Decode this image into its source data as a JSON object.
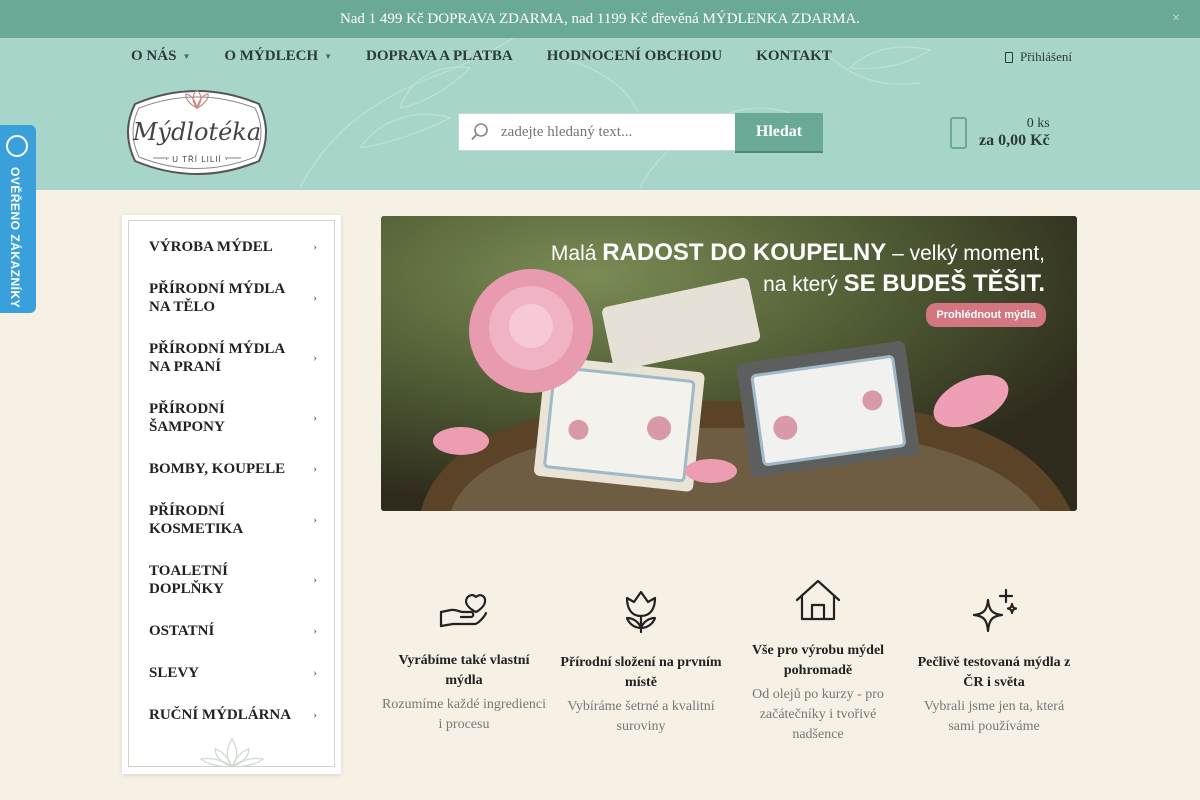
{
  "topbar": {
    "text": "Nad 1 499 Kč DOPRAVA ZDARMA, nad 1199 Kč dřevěná MÝDLENKA ZDARMA.",
    "close": "×"
  },
  "nav": {
    "items": [
      "O NÁS",
      "O MÝDLECH",
      "DOPRAVA A PLATBA",
      "HODNOCENÍ OBCHODU",
      "KONTAKT"
    ],
    "login": "Přihlášení"
  },
  "logo": {
    "name": "Mýdlotéka",
    "tagline": "U TŘÍ LILIÍ"
  },
  "search": {
    "placeholder": "zadejte hledaný text...",
    "button": "Hledat"
  },
  "cart": {
    "count": "0 ks",
    "total": "za 0,00 Kč"
  },
  "badge": {
    "text": "OVĚŘENO ZÁKAZNÍKY"
  },
  "sidebar": {
    "categories": [
      "VÝROBA MÝDEL",
      "PŘÍRODNÍ MÝDLA NA TĚLO",
      "PŘÍRODNÍ MÝDLA NA PRANÍ",
      "PŘÍRODNÍ ŠAMPONY",
      "BOMBY, KOUPELE",
      "PŘÍRODNÍ KOSMETIKA",
      "TOALETNÍ DOPLŇKY",
      "OSTATNÍ",
      "SLEVY",
      "RUČNÍ MÝDLÁRNA"
    ]
  },
  "banner": {
    "line1_a": "Malá ",
    "line1_b": "RADOST DO KOUPELNY",
    "line1_c": " – velký moment,",
    "line2_a": "na který ",
    "line2_b": "SE BUDEŠ TĚŠIT.",
    "cta": "Prohlédnout mýdla"
  },
  "features": [
    {
      "icon": "hand-heart-icon",
      "title": "Vyrábíme také vlastní mýdla",
      "text": "Rozumíme každé ingredienci i procesu"
    },
    {
      "icon": "tulip-icon",
      "title": "Přírodní složení na prvním místě",
      "text": "Vybíráme šetrné a kvalitní suroviny"
    },
    {
      "icon": "house-icon",
      "title": "Vše pro výrobu mýdel pohromadě",
      "text": "Od olejů po kurzy - pro začátečníky i tvořivé nadšence"
    },
    {
      "icon": "sparkles-icon",
      "title": "Pečlivě testovaná mýdla z ČR i světa",
      "text": "Vybrali jsme jen ta, která sami používáme"
    }
  ],
  "colors": {
    "accent": "#6aa898",
    "header": "#a8d5ca",
    "background": "#f6f1e4",
    "badge": "#3aa0dc",
    "cta": "#d47682"
  }
}
